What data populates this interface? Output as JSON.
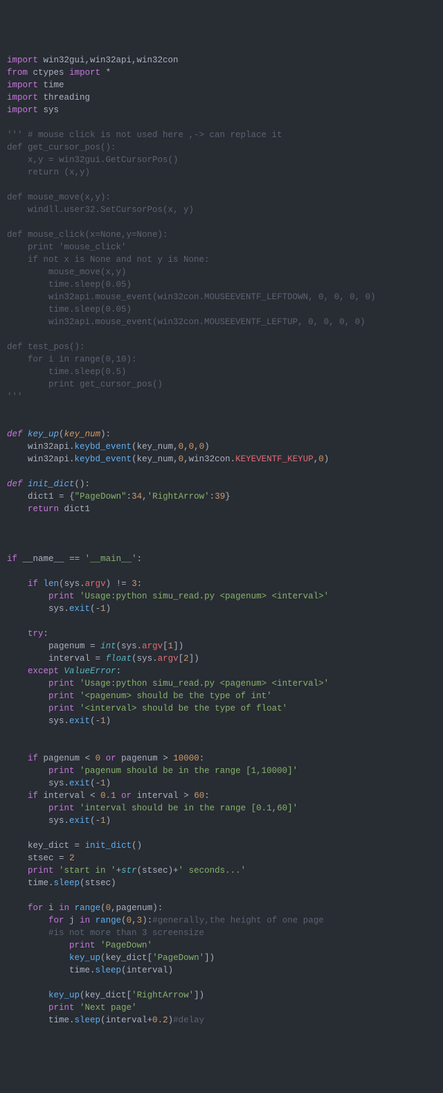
{
  "lines": [
    {
      "type": "code",
      "segs": [
        [
          "k-import",
          "import"
        ],
        [
          "",
          ", "
        ],
        [
          "mod",
          " win32gui,win32api,win32con"
        ]
      ],
      "raw": "import win32gui,win32api,win32con"
    },
    {
      "type": "code",
      "raw": "from ctypes import *"
    },
    {
      "type": "code",
      "raw": "import time"
    },
    {
      "type": "code",
      "raw": "import threading"
    },
    {
      "type": "code",
      "raw": "import sys"
    },
    {
      "type": "blank"
    },
    {
      "type": "dim",
      "raw": "''' # mouse click is not used here ,-> can replace it"
    },
    {
      "type": "dim",
      "raw": "def get_cursor_pos():"
    },
    {
      "type": "dim",
      "raw": "    x,y = win32gui.GetCursorPos()"
    },
    {
      "type": "dim",
      "raw": "    return (x,y)"
    },
    {
      "type": "blank"
    },
    {
      "type": "dim",
      "raw": "def mouse_move(x,y):"
    },
    {
      "type": "dim",
      "raw": "    windll.user32.SetCursorPos(x, y)"
    },
    {
      "type": "blank"
    },
    {
      "type": "dim",
      "raw": "def mouse_click(x=None,y=None):"
    },
    {
      "type": "dim",
      "raw": "    print 'mouse_click'"
    },
    {
      "type": "dim",
      "raw": "    if not x is None and not y is None:"
    },
    {
      "type": "dim",
      "raw": "        mouse_move(x,y)"
    },
    {
      "type": "dim",
      "raw": "        time.sleep(0.05)"
    },
    {
      "type": "dim",
      "raw": "        win32api.mouse_event(win32con.MOUSEEVENTF_LEFTDOWN, 0, 0, 0, 0)"
    },
    {
      "type": "dim",
      "raw": "        time.sleep(0.05)"
    },
    {
      "type": "dim",
      "raw": "        win32api.mouse_event(win32con.MOUSEEVENTF_LEFTUP, 0, 0, 0, 0)"
    },
    {
      "type": "blank"
    },
    {
      "type": "dim",
      "raw": "def test_pos():"
    },
    {
      "type": "dim",
      "raw": "    for i in range(0,10):"
    },
    {
      "type": "dim",
      "raw": "        time.sleep(0.5)"
    },
    {
      "type": "dim",
      "raw": "        print get_cursor_pos()"
    },
    {
      "type": "dim",
      "raw": "'''"
    },
    {
      "type": "blank"
    },
    {
      "type": "blank"
    },
    {
      "type": "h",
      "html": "<span class='k-def'>def</span> <span class='fn'>key_up</span><span class='punc'>(</span><span class='param'>key_num</span><span class='punc'>):</span>"
    },
    {
      "type": "h",
      "html": "    <span class='var'>win32api</span><span class='punc'>.</span><span class='call'>keybd_event</span><span class='punc'>(</span><span class='var'>key_num</span><span class='punc'>,</span><span class='num'>0</span><span class='punc'>,</span><span class='num'>0</span><span class='punc'>,</span><span class='num'>0</span><span class='punc'>)</span>"
    },
    {
      "type": "h",
      "html": "    <span class='var'>win32api</span><span class='punc'>.</span><span class='call'>keybd_event</span><span class='punc'>(</span><span class='var'>key_num</span><span class='punc'>,</span><span class='num'>0</span><span class='punc'>,</span><span class='var'>win32con</span><span class='punc'>.</span><span class='attr'>KEYEVENTF_KEYUP</span><span class='punc'>,</span><span class='num'>0</span><span class='punc'>)</span>"
    },
    {
      "type": "blank"
    },
    {
      "type": "h",
      "html": "<span class='k-def'>def</span> <span class='fn'>init_dict</span><span class='punc'>():</span>"
    },
    {
      "type": "h",
      "html": "    <span class='var'>dict1</span> <span class='eq'>=</span> <span class='punc'>{</span><span class='str'>\"PageDown\"</span><span class='punc'>:</span><span class='num'>34</span><span class='punc'>,</span><span class='str'>'RightArrow'</span><span class='punc'>:</span><span class='num'>39</span><span class='punc'>}</span>"
    },
    {
      "type": "h",
      "html": "    <span class='k-return'>return</span> <span class='var'>dict1</span>"
    },
    {
      "type": "blank"
    },
    {
      "type": "blank"
    },
    {
      "type": "blank"
    },
    {
      "type": "h",
      "html": "<span class='k-if'>if</span> <span class='var'>__name__</span> <span class='op'>==</span> <span class='str'>'__main__'</span><span class='punc'>:</span>"
    },
    {
      "type": "blank"
    },
    {
      "type": "h",
      "html": "    <span class='k-if'>if</span> <span class='call'>len</span><span class='punc'>(</span><span class='var'>sys</span><span class='punc'>.</span><span class='attr'>argv</span><span class='punc'>)</span> <span class='op'>!=</span> <span class='num'>3</span><span class='punc'>:</span>"
    },
    {
      "type": "h",
      "html": "        <span class='k-if'>print</span> <span class='str'>'Usage:python simu_read.py &lt;pagenum&gt; &lt;interval&gt;'</span>"
    },
    {
      "type": "h",
      "html": "        <span class='var'>sys</span><span class='punc'>.</span><span class='call'>exit</span><span class='punc'>(</span><span class='op'>-</span><span class='num'>1</span><span class='punc'>)</span>"
    },
    {
      "type": "blank"
    },
    {
      "type": "h",
      "html": "    <span class='k-try'>try</span><span class='punc'>:</span>"
    },
    {
      "type": "h",
      "html": "        <span class='var'>pagenum</span> <span class='eq'>=</span> <span class='builtin'>int</span><span class='punc'>(</span><span class='var'>sys</span><span class='punc'>.</span><span class='attr'>argv</span><span class='punc'>[</span><span class='num'>1</span><span class='punc'>])</span>"
    },
    {
      "type": "h",
      "html": "        <span class='var'>interval</span> <span class='eq'>=</span> <span class='builtin'>float</span><span class='punc'>(</span><span class='var'>sys</span><span class='punc'>.</span><span class='attr'>argv</span><span class='punc'>[</span><span class='num'>2</span><span class='punc'>])</span>"
    },
    {
      "type": "h",
      "html": "    <span class='k-except'>except</span> <span class='builtin'>ValueError</span><span class='punc'>:</span>"
    },
    {
      "type": "h",
      "html": "        <span class='k-if'>print</span> <span class='str'>'Usage:python simu_read.py &lt;pagenum&gt; &lt;interval&gt;'</span>"
    },
    {
      "type": "h",
      "html": "        <span class='k-if'>print</span> <span class='str'>'&lt;pagenum&gt; should be the type of int'</span>"
    },
    {
      "type": "h",
      "html": "        <span class='k-if'>print</span> <span class='str'>'&lt;interval&gt; should be the type of float'</span>"
    },
    {
      "type": "h",
      "html": "        <span class='var'>sys</span><span class='punc'>.</span><span class='call'>exit</span><span class='punc'>(</span><span class='op'>-</span><span class='num'>1</span><span class='punc'>)</span>"
    },
    {
      "type": "blank"
    },
    {
      "type": "blank"
    },
    {
      "type": "h",
      "html": "    <span class='k-if'>if</span> <span class='var'>pagenum</span> <span class='op'>&lt;</span> <span class='num'>0</span> <span class='k-or'>or</span> <span class='var'>pagenum</span> <span class='op'>&gt;</span> <span class='num'>10000</span><span class='punc'>:</span>"
    },
    {
      "type": "h",
      "html": "        <span class='k-if'>print</span> <span class='str'>'pagenum should be in the range [1,10000]'</span>"
    },
    {
      "type": "h",
      "html": "        <span class='var'>sys</span><span class='punc'>.</span><span class='call'>exit</span><span class='punc'>(</span><span class='op'>-</span><span class='num'>1</span><span class='punc'>)</span>"
    },
    {
      "type": "h",
      "html": "    <span class='k-if'>if</span> <span class='var'>interval</span> <span class='op'>&lt;</span> <span class='num'>0.1</span> <span class='k-or'>or</span> <span class='var'>interval</span> <span class='op'>&gt;</span> <span class='num'>60</span><span class='punc'>:</span>"
    },
    {
      "type": "h",
      "html": "        <span class='k-if'>print</span> <span class='str'>'interval should be in the range [0.1,60]'</span>"
    },
    {
      "type": "h",
      "html": "        <span class='var'>sys</span><span class='punc'>.</span><span class='call'>exit</span><span class='punc'>(</span><span class='op'>-</span><span class='num'>1</span><span class='punc'>)</span>"
    },
    {
      "type": "blank"
    },
    {
      "type": "h",
      "html": "    <span class='var'>key_dict</span> <span class='eq'>=</span> <span class='call'>init_dict</span><span class='punc'>()</span>"
    },
    {
      "type": "h",
      "html": "    <span class='var'>stsec</span> <span class='eq'>=</span> <span class='num'>2</span>"
    },
    {
      "type": "h",
      "html": "    <span class='k-if'>print</span> <span class='str'>'start in '</span><span class='op'>+</span><span class='builtin'>str</span><span class='punc'>(</span><span class='var'>stsec</span><span class='punc'>)</span><span class='op'>+</span><span class='str'>' seconds...'</span>"
    },
    {
      "type": "h",
      "html": "    <span class='var'>time</span><span class='punc'>.</span><span class='call'>sleep</span><span class='punc'>(</span><span class='var'>stsec</span><span class='punc'>)</span>"
    },
    {
      "type": "blank"
    },
    {
      "type": "h",
      "html": "    <span class='k-for'>for</span> <span class='var'>i</span> <span class='k-in'>in</span> <span class='call'>range</span><span class='punc'>(</span><span class='num'>0</span><span class='punc'>,</span><span class='var'>pagenum</span><span class='punc'>):</span>"
    },
    {
      "type": "h",
      "html": "        <span class='k-for'>for</span> <span class='var'>j</span> <span class='k-in'>in</span> <span class='call'>range</span><span class='punc'>(</span><span class='num'>0</span><span class='punc'>,</span><span class='num'>3</span><span class='punc'>):</span><span class='comment'>#generally,the height of one page</span>"
    },
    {
      "type": "h",
      "html": "        <span class='comment'>#is not more than 3 screensize</span>"
    },
    {
      "type": "h",
      "html": "            <span class='k-if'>print</span> <span class='str'>'PageDown'</span>"
    },
    {
      "type": "h",
      "html": "            <span class='call'>key_up</span><span class='punc'>(</span><span class='var'>key_dict</span><span class='punc'>[</span><span class='str'>'PageDown'</span><span class='punc'>])</span>"
    },
    {
      "type": "h",
      "html": "            <span class='var'>time</span><span class='punc'>.</span><span class='call'>sleep</span><span class='punc'>(</span><span class='var'>interval</span><span class='punc'>)</span>"
    },
    {
      "type": "blank"
    },
    {
      "type": "h",
      "html": "        <span class='call'>key_up</span><span class='punc'>(</span><span class='var'>key_dict</span><span class='punc'>[</span><span class='str'>'RightArrow'</span><span class='punc'>])</span>"
    },
    {
      "type": "h",
      "html": "        <span class='k-if'>print</span> <span class='str'>'Next page'</span>"
    },
    {
      "type": "h",
      "html": "        <span class='var'>time</span><span class='punc'>.</span><span class='call'>sleep</span><span class='punc'>(</span><span class='var'>interval</span><span class='op'>+</span><span class='num'>0.2</span><span class='punc'>)</span><span class='comment'>#delay</span>"
    }
  ],
  "importLines": [
    "win32gui,win32api,win32con",
    "ctypes",
    "time",
    "threading",
    "sys"
  ]
}
